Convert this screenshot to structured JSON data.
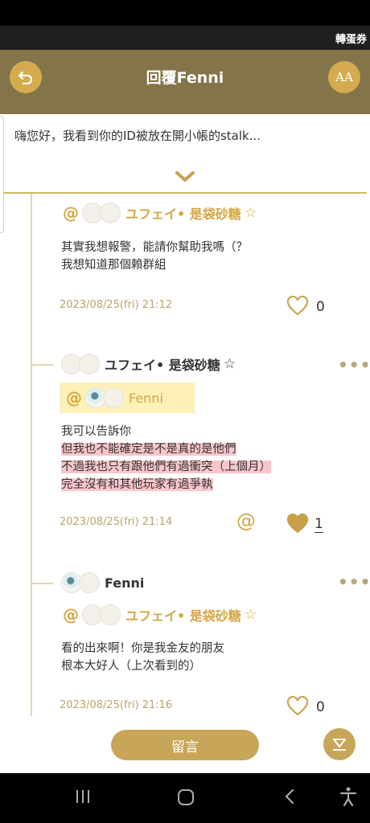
{
  "status_banner": {
    "text": "轉蛋券"
  },
  "header": {
    "title": "回覆Fenni",
    "font_size_label": "AA"
  },
  "quoted_post": {
    "text": "嗨您好，我看到你的ID被放在開小帳的stalk..."
  },
  "comments": [
    {
      "mention": "ユフェイ• 是袋砂糖",
      "mention_star": "☆",
      "lines": [
        "其實我想報警，能請你幫助我嗎（？",
        "我想知道那個賴群組"
      ],
      "time": "2023/08/25(fri) 21:12",
      "likes": "0"
    },
    {
      "author": "ユフェイ• 是袋砂糖",
      "author_star": "☆",
      "menu": "•••",
      "mention": "Fenni",
      "lines": [
        "我可以告訴你",
        "但我也不能確定是不是真的是他們",
        "不過我也只有跟他們有過衝突（上個月）",
        "完全沒有和其他玩家有過爭執"
      ],
      "time": "2023/08/25(fri) 21:14",
      "at_icon": "@",
      "likes": "1"
    },
    {
      "author": "Fenni",
      "menu": "•••",
      "mention": "ユフェイ• 是袋砂糖",
      "mention_star": "☆",
      "lines": [
        "看的出來啊！你是我金友的朋友",
        "根本大好人（上次看到的）"
      ],
      "time": "2023/08/25(fri) 21:16",
      "likes": "0"
    }
  ],
  "footer": {
    "reply_button": "留言"
  },
  "colors": {
    "header": "#84744a",
    "accent": "#d6a641",
    "button": "#c8a659",
    "highlight": "#f8c6cc"
  },
  "nav": {
    "recents": "|||",
    "home": "○",
    "back": "<",
    "accessibility": "accessibility-icon"
  }
}
